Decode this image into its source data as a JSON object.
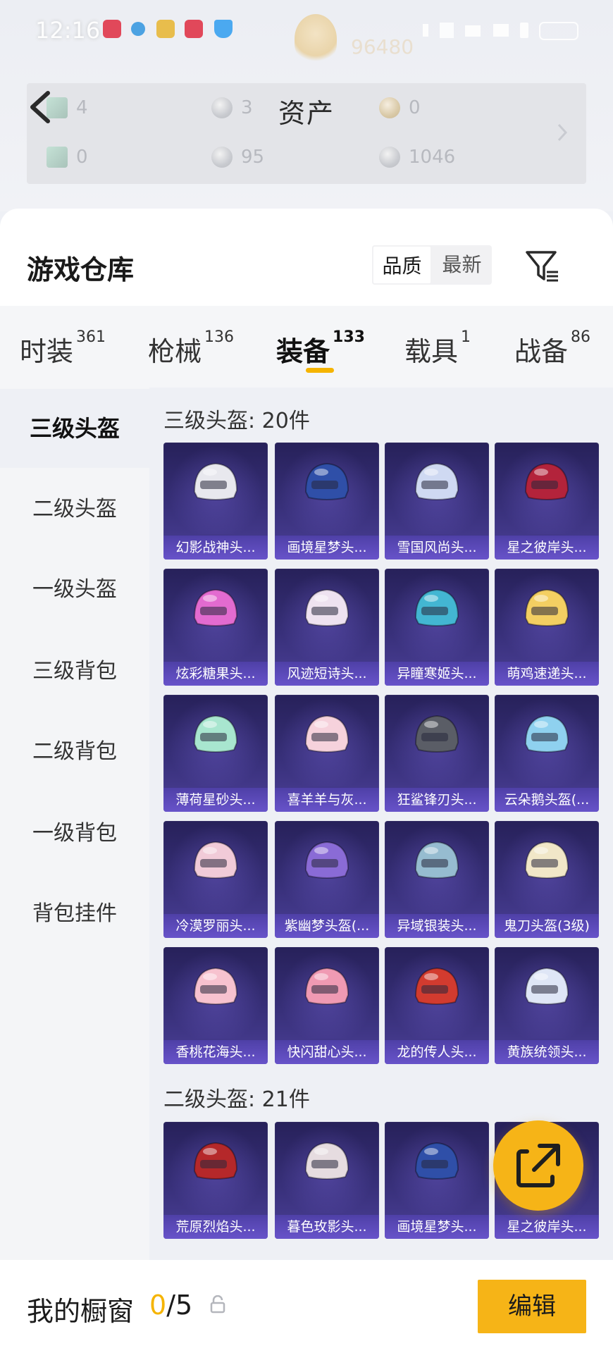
{
  "status_bar": {
    "time": "12:16",
    "right": ""
  },
  "header": {
    "gold_amount": "96480",
    "title": "资产",
    "assets": [
      {
        "value": "4",
        "icon": "ticket-icon"
      },
      {
        "value": "3",
        "icon": "silver-coin-icon"
      },
      {
        "value": "0",
        "icon": "gold-coin-icon"
      },
      {
        "value": "0",
        "icon": "card-icon"
      },
      {
        "value": "95",
        "icon": "silver-coin-icon"
      },
      {
        "value": "1046",
        "icon": "pearl-coin-icon"
      }
    ]
  },
  "warehouse": {
    "title": "游戏仓库",
    "sort": {
      "quality": "品质",
      "newest": "最新"
    }
  },
  "tabs": [
    {
      "label": "时装",
      "count": "361"
    },
    {
      "label": "枪械",
      "count": "136"
    },
    {
      "label": "装备",
      "count": "133",
      "active": true
    },
    {
      "label": "载具",
      "count": "1"
    },
    {
      "label": "战备",
      "count": "86"
    }
  ],
  "sidebar": {
    "items": [
      {
        "label": "三级头盔",
        "active": true
      },
      {
        "label": "二级头盔"
      },
      {
        "label": "一级头盔"
      },
      {
        "label": "三级背包"
      },
      {
        "label": "二级背包"
      },
      {
        "label": "一级背包"
      },
      {
        "label": "背包挂件"
      }
    ]
  },
  "sections": [
    {
      "title": "三级头盔: 20件",
      "items": [
        {
          "name": "幻影战神头...",
          "color": "#e8e8ee"
        },
        {
          "name": "画境星梦头...",
          "color": "#2f4fa8"
        },
        {
          "name": "雪国风尚头...",
          "color": "#cfd9f2"
        },
        {
          "name": "星之彼岸头...",
          "color": "#b3233b"
        },
        {
          "name": "炫彩糖果头...",
          "color": "#e36bd0"
        },
        {
          "name": "风迹短诗头...",
          "color": "#eee2f0"
        },
        {
          "name": "异瞳寒姬头...",
          "color": "#43b6d2"
        },
        {
          "name": "萌鸡速递头...",
          "color": "#f3cf62"
        },
        {
          "name": "薄荷星砂头...",
          "color": "#a8e6cf"
        },
        {
          "name": "喜羊羊与灰...",
          "color": "#f6d2dc"
        },
        {
          "name": "狂鲨锋刃头...",
          "color": "#5a5d66"
        },
        {
          "name": "云朵鹅头盔(...",
          "color": "#8fd1ef"
        },
        {
          "name": "冷漠罗丽头...",
          "color": "#f1cbd8"
        },
        {
          "name": "紫幽梦头盔(...",
          "color": "#8a6bd6"
        },
        {
          "name": "异域银装头...",
          "color": "#96bcd0"
        },
        {
          "name": "鬼刀头盔(3级)",
          "color": "#f1e7c8"
        },
        {
          "name": "香桃花海头...",
          "color": "#f7c2cf"
        },
        {
          "name": "快闪甜心头...",
          "color": "#f09ab3"
        },
        {
          "name": "龙的传人头...",
          "color": "#d23b2f"
        },
        {
          "name": "黄族统领头...",
          "color": "#dfe6f6"
        }
      ]
    },
    {
      "title": "二级头盔: 21件",
      "items": [
        {
          "name": "荒原烈焰头...",
          "color": "#b5282a"
        },
        {
          "name": "暮色玫影头...",
          "color": "#e6dce0"
        },
        {
          "name": "画境星梦头...",
          "color": "#2f4fa8"
        },
        {
          "name": "星之彼岸头...",
          "color": "#b3233b"
        }
      ]
    }
  ],
  "showcase": {
    "label": "我的橱窗",
    "current": "0",
    "total": "/5",
    "edit": "编辑"
  },
  "colors": {
    "accent": "#f6b417",
    "cell_bg": "#38307a"
  }
}
